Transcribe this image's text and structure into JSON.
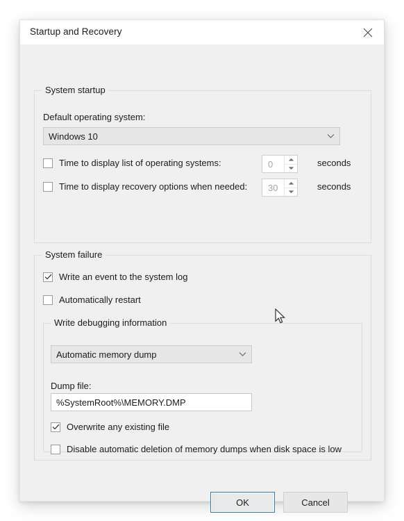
{
  "window": {
    "title": "Startup and Recovery",
    "close_icon": "close-icon"
  },
  "system_startup": {
    "group_label": "System startup",
    "default_os_label": "Default operating system:",
    "default_os_value": "Windows 10",
    "default_os_chevron": "chevron-down-icon",
    "timeout_os": {
      "checkbox_label": "Time to display list of operating systems:",
      "checked": false,
      "value": "0",
      "units": "seconds"
    },
    "timeout_recovery": {
      "checkbox_label": "Time to display recovery options when needed:",
      "checked": false,
      "value": "30",
      "units": "seconds"
    }
  },
  "system_failure": {
    "group_label": "System failure",
    "write_event": {
      "label": "Write an event to the system log",
      "checked": true
    },
    "auto_restart": {
      "label": "Automatically restart",
      "checked": false
    },
    "debug_group": {
      "group_label": "Write debugging information",
      "dump_type_value": "Automatic memory dump",
      "dump_type_chevron": "chevron-down-icon",
      "dump_file_label": "Dump file:",
      "dump_file_value": "%SystemRoot%\\MEMORY.DMP",
      "overwrite": {
        "label": "Overwrite any existing file",
        "checked": true
      },
      "disable_deletion": {
        "label": "Disable automatic deletion of memory dumps when disk space is low",
        "checked": false
      }
    }
  },
  "footer": {
    "ok_label": "OK",
    "cancel_label": "Cancel"
  },
  "colors": {
    "accent_blue": "#2f7cb0",
    "dialog_bg": "#f0f0f0",
    "titlebar_bg": "#ffffff",
    "text": "#1b1b1b",
    "disabled_text": "#a6a6a6",
    "border": "#dcdcdc"
  }
}
